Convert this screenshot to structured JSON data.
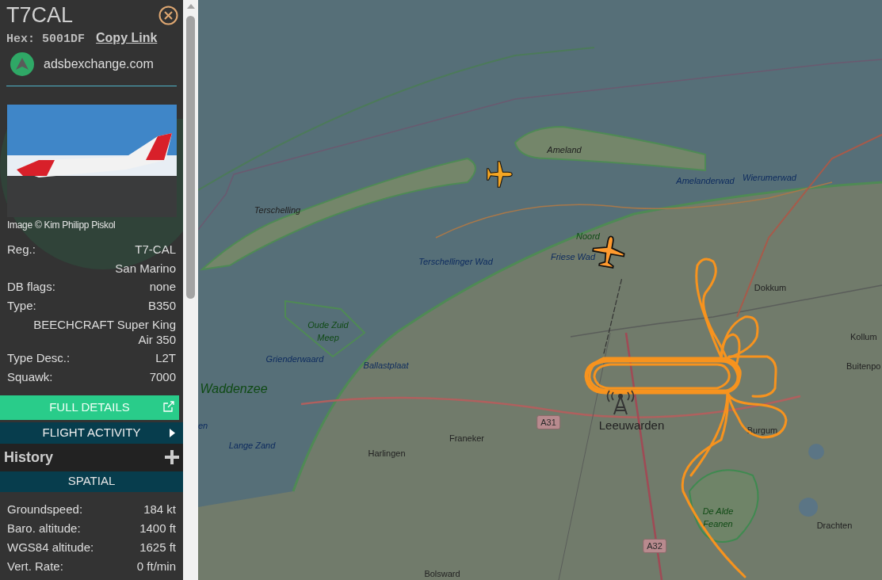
{
  "sidebar": {
    "title": "T7CAL",
    "hex_label": "Hex:",
    "hex_value": "5001DF",
    "copy_link": "Copy Link",
    "source": "adsbexchange.com",
    "photo_credit": "Image © Kim Philipp Piskol",
    "info_rows": [
      {
        "label": "Reg.:",
        "value": "T7-CAL"
      },
      {
        "label": "",
        "value": "San Marino"
      },
      {
        "label": "DB flags:",
        "value": "none"
      },
      {
        "label": "Type:",
        "value": "B350"
      },
      {
        "label": "",
        "value": "BEECHCRAFT Super King Air 350"
      },
      {
        "label": "Type Desc.:",
        "value": "L2T"
      },
      {
        "label": "Squawk:",
        "value": "7000"
      }
    ],
    "full_details": "FULL DETAILS",
    "flight_activity": "FLIGHT ACTIVITY",
    "flight_activity_expanded": false,
    "history": "History",
    "history_expanded": false,
    "spatial": "SPATIAL",
    "spatial_rows": [
      {
        "label": "Groundspeed:",
        "value": "184 kt"
      },
      {
        "label": "Baro. altitude:",
        "value": "1400 ft"
      },
      {
        "label": "WGS84 altitude:",
        "value": "1625 ft"
      },
      {
        "label": "Vert. Rate:",
        "value": "0 ft/min"
      }
    ]
  },
  "map": {
    "labels": [
      {
        "text": "Ameland",
        "kind": "island"
      },
      {
        "text": "Amelanderwad",
        "kind": "water"
      },
      {
        "text": "Wierumerwad",
        "kind": "water"
      },
      {
        "text": "Terschelling",
        "kind": "island"
      },
      {
        "text": "Terschellinger Wad",
        "kind": "water"
      },
      {
        "text": "Noord",
        "kind": "nature"
      },
      {
        "text": "Friese Wad",
        "kind": "water"
      },
      {
        "text": "Oude Zuid Meep",
        "kind": "nature"
      },
      {
        "text": "Grienderwaard",
        "kind": "water"
      },
      {
        "text": "Ballastplaat",
        "kind": "water"
      },
      {
        "text": "Waddenzee",
        "kind": "sea"
      },
      {
        "text": "en",
        "kind": "water"
      },
      {
        "text": "Dokkum",
        "kind": "town"
      },
      {
        "text": "Kollum",
        "kind": "town"
      },
      {
        "text": "Buitenpo",
        "kind": "town"
      },
      {
        "text": "Lange Zand",
        "kind": "water"
      },
      {
        "text": "A31",
        "kind": "road"
      },
      {
        "text": "Leeuwarden",
        "kind": "city"
      },
      {
        "text": "Franeker",
        "kind": "town"
      },
      {
        "text": "Harlingen",
        "kind": "town"
      },
      {
        "text": "Burgum",
        "kind": "town"
      },
      {
        "text": "De Alde Feanen",
        "kind": "nature"
      },
      {
        "text": "Drachten",
        "kind": "town"
      },
      {
        "text": "A32",
        "kind": "road"
      },
      {
        "text": "Bolsward",
        "kind": "town"
      }
    ],
    "aircraft": [
      {
        "selected": false
      },
      {
        "selected": true
      }
    ]
  }
}
